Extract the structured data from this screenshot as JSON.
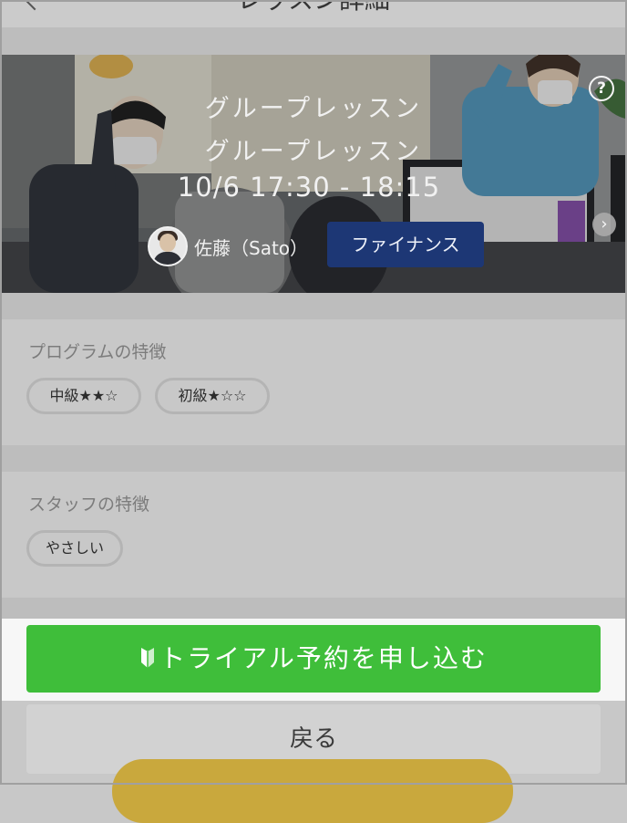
{
  "header": {
    "title": "レッスン詳細"
  },
  "hero": {
    "title_line1": "グループレッスン",
    "title_line2": "グループレッスン",
    "datetime": "10/6  17:30 - 18:15",
    "staff_name": "佐藤（Sato）",
    "category": "ファイナンス",
    "help_symbol": "?",
    "next_symbol": "›"
  },
  "program_features": {
    "title": "プログラムの特徴",
    "tags": [
      "中級★★☆",
      "初級★☆☆"
    ]
  },
  "staff_features": {
    "title": "スタッフの特徴",
    "tags": [
      "やさしい"
    ]
  },
  "actions": {
    "trial_label": "トライアル予約を申し込む",
    "back_label": "戻る"
  },
  "colors": {
    "accent_green": "#3fbe3a",
    "category_navy": "#1d3775",
    "floating_gold": "#c9a83d"
  },
  "icons": [
    "help-icon",
    "chevron-right-icon",
    "beginner-leaf-icon"
  ]
}
